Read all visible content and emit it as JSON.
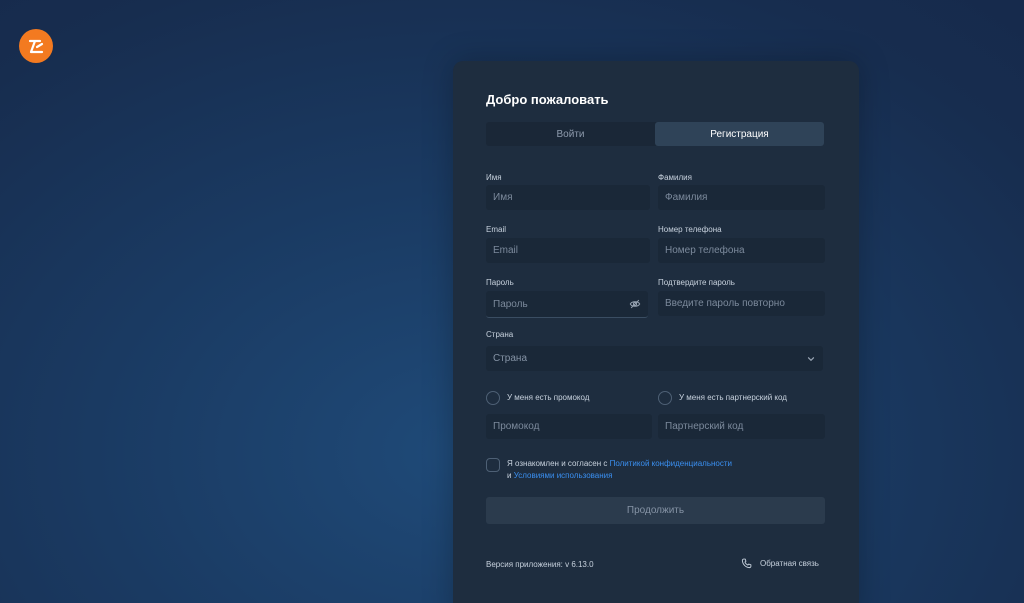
{
  "card": {
    "title": "Добро пожаловать"
  },
  "tabs": [
    {
      "label": "Войти",
      "active": false
    },
    {
      "label": "Регистрация",
      "active": true
    }
  ],
  "form": {
    "first_name": {
      "label": "Имя",
      "placeholder": "Имя"
    },
    "last_name": {
      "label": "Фамилия",
      "placeholder": "Фамилия"
    },
    "email": {
      "label": "Email",
      "placeholder": "Email"
    },
    "phone": {
      "label": "Номер телефона",
      "placeholder": "Номер телефона"
    },
    "password": {
      "label": "Пароль",
      "placeholder": "Пароль"
    },
    "confirm_password": {
      "label": "Подтвердите пароль",
      "placeholder": "Введите пароль повторно"
    },
    "country": {
      "label": "Страна",
      "selected": "Страна"
    },
    "promo_checkbox": {
      "label": "У меня есть промокод",
      "checked": false
    },
    "partner_checkbox": {
      "label": "У меня есть партнерский код",
      "checked": false
    },
    "promo_code": {
      "placeholder": "Промокод"
    },
    "partner_code": {
      "placeholder": "Партнерский код"
    },
    "agreement": {
      "checked": false,
      "text_1": "Я ознакомлен и согласен с",
      "link_1": "Политикой конфиденциальности",
      "text_2": "и",
      "link_2": "Условиями использования"
    },
    "submit_label": "Продолжить"
  },
  "footer": {
    "version": "Версия приложения: v 6.13.0",
    "feedback_label": "Обратная связь"
  },
  "icons": {
    "logo": "app-logo-icon",
    "password_toggle": "eye-off-icon",
    "country_dropdown": "chevron-down-icon",
    "feedback": "phone-icon"
  },
  "colors": {
    "brand": "#f37a20",
    "link": "#3a8ff0",
    "card": "#1e2d3f"
  }
}
